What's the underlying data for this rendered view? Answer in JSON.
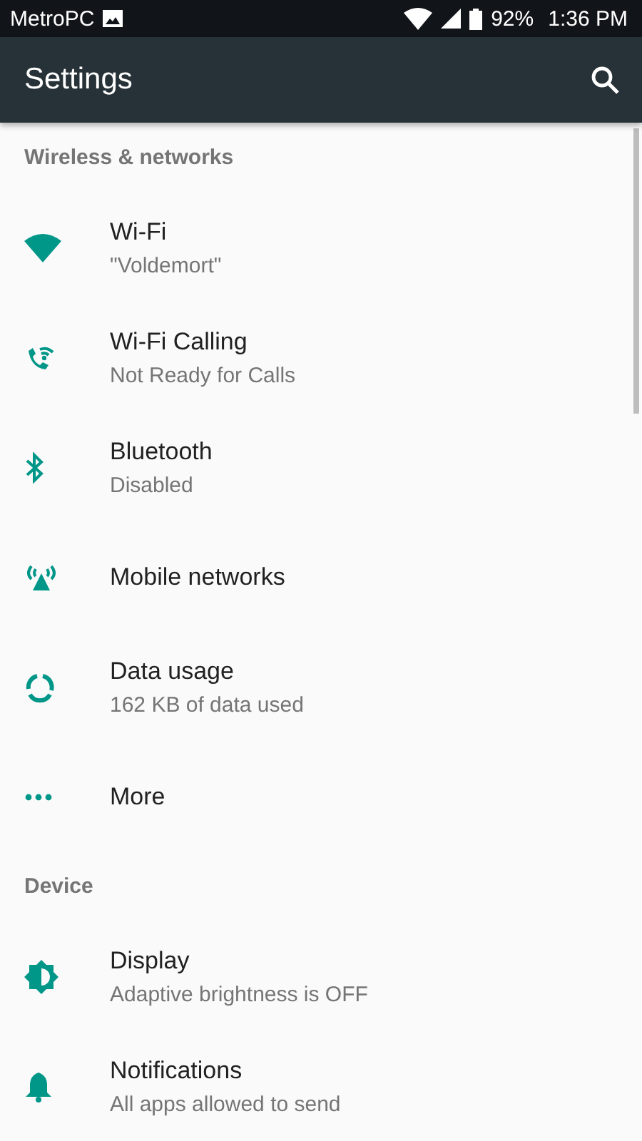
{
  "status_bar": {
    "carrier": "MetroPC",
    "battery": "92%",
    "time": "1:36 PM"
  },
  "toolbar": {
    "title": "Settings"
  },
  "sections": [
    {
      "header": "Wireless & networks",
      "items": [
        {
          "title": "Wi-Fi",
          "summary": "\"Voldemort\""
        },
        {
          "title": "Wi-Fi Calling",
          "summary": "Not Ready for Calls"
        },
        {
          "title": "Bluetooth",
          "summary": "Disabled"
        },
        {
          "title": "Mobile networks"
        },
        {
          "title": "Data usage",
          "summary": "162 KB of data used"
        },
        {
          "title": "More"
        }
      ]
    },
    {
      "header": "Device",
      "items": [
        {
          "title": "Display",
          "summary": "Adaptive brightness is OFF"
        },
        {
          "title": "Notifications",
          "summary": "All apps allowed to send"
        }
      ]
    }
  ]
}
